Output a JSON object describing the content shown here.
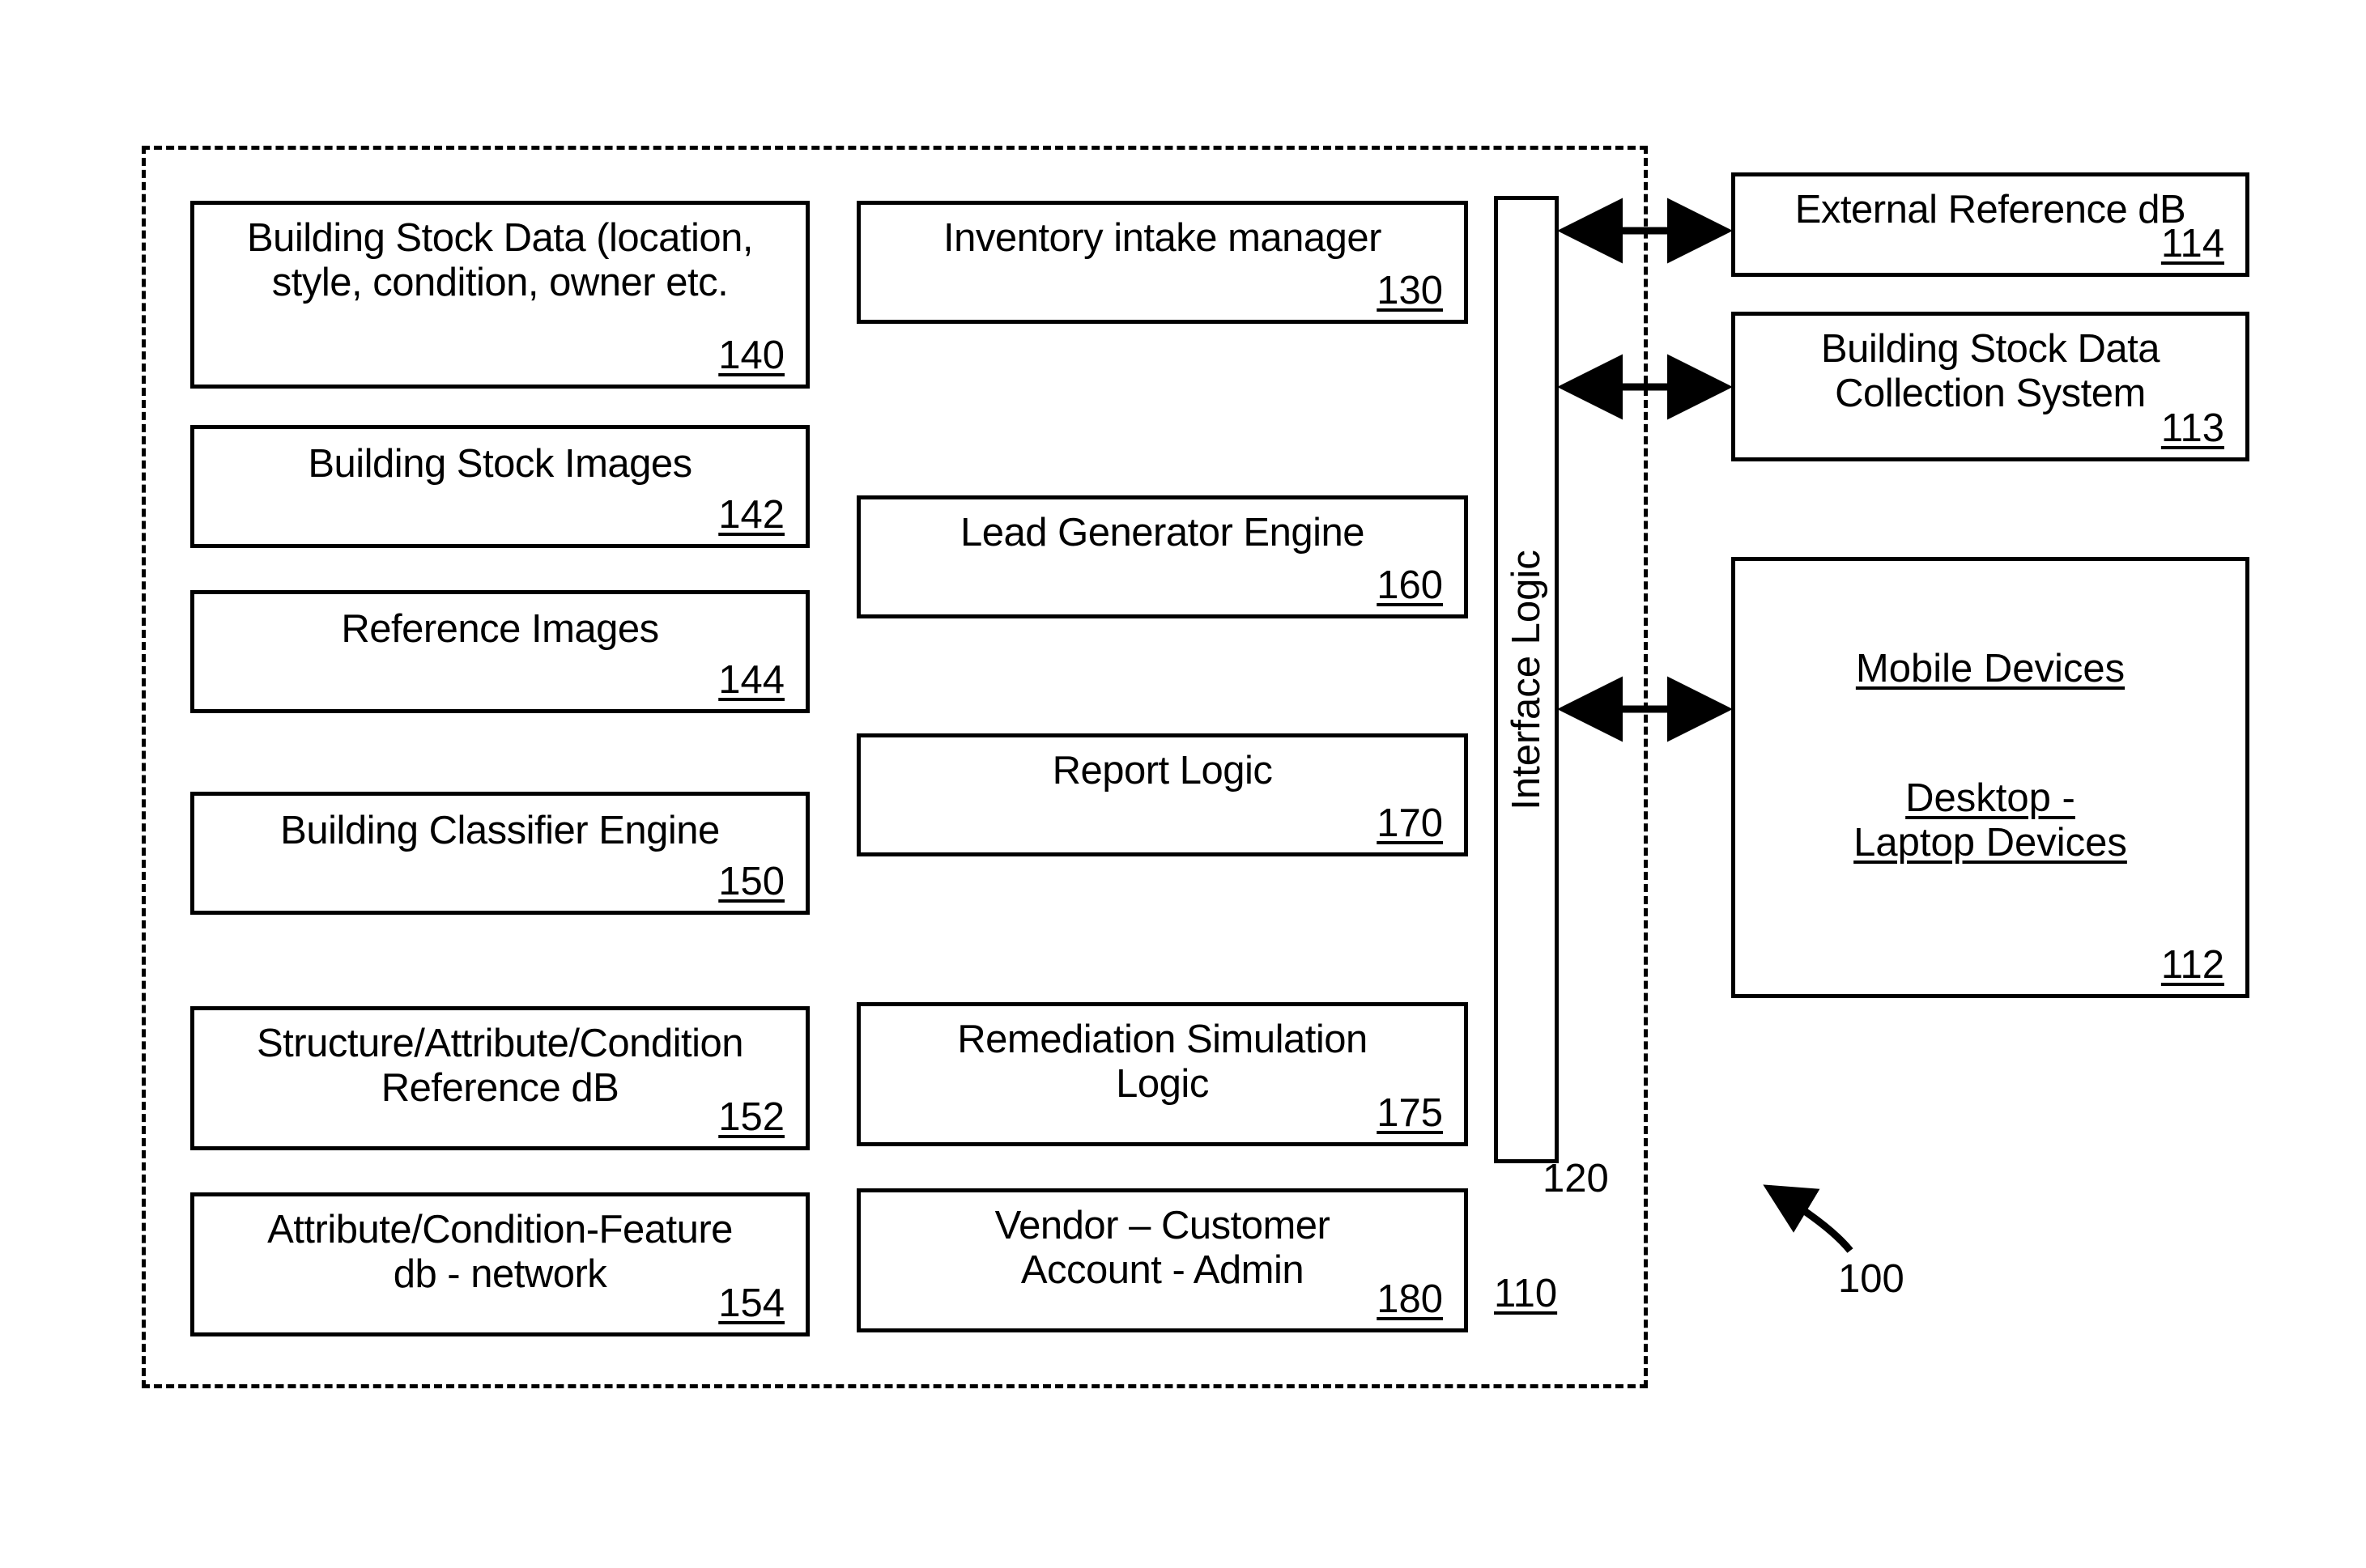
{
  "figure": {
    "system_ref": "110",
    "interface_ref": "120",
    "overall_ref": "100",
    "interface_label": "Interface Logic"
  },
  "left_column": [
    {
      "title": "Building Stock Data (location,\nstyle, condition, owner etc.",
      "ref": "140"
    },
    {
      "title": "Building Stock Images",
      "ref": "142"
    },
    {
      "title": "Reference Images",
      "ref": "144"
    },
    {
      "title": "Building Classifier Engine",
      "ref": "150"
    },
    {
      "title": "Structure/Attribute/Condition\nReference dB",
      "ref": "152"
    },
    {
      "title": "Attribute/Condition-Feature\ndb - network",
      "ref": "154"
    }
  ],
  "middle_column": [
    {
      "title": "Inventory intake manager",
      "ref": "130"
    },
    {
      "title": "Lead Generator Engine",
      "ref": "160"
    },
    {
      "title": "Report Logic",
      "ref": "170"
    },
    {
      "title": "Remediation Simulation\nLogic",
      "ref": "175"
    },
    {
      "title": "Vendor – Customer\nAccount - Admin",
      "ref": "180"
    }
  ],
  "right_column": [
    {
      "title": "External Reference dB",
      "ref": "114"
    },
    {
      "title": "Building Stock Data\nCollection System",
      "ref": "113"
    }
  ],
  "devices_panel": {
    "line1": "Mobile Devices",
    "line2": "Desktop -",
    "line3": "Laptop Devices",
    "ref": "112"
  },
  "colors": {
    "stroke": "#000000",
    "background": "#ffffff"
  }
}
